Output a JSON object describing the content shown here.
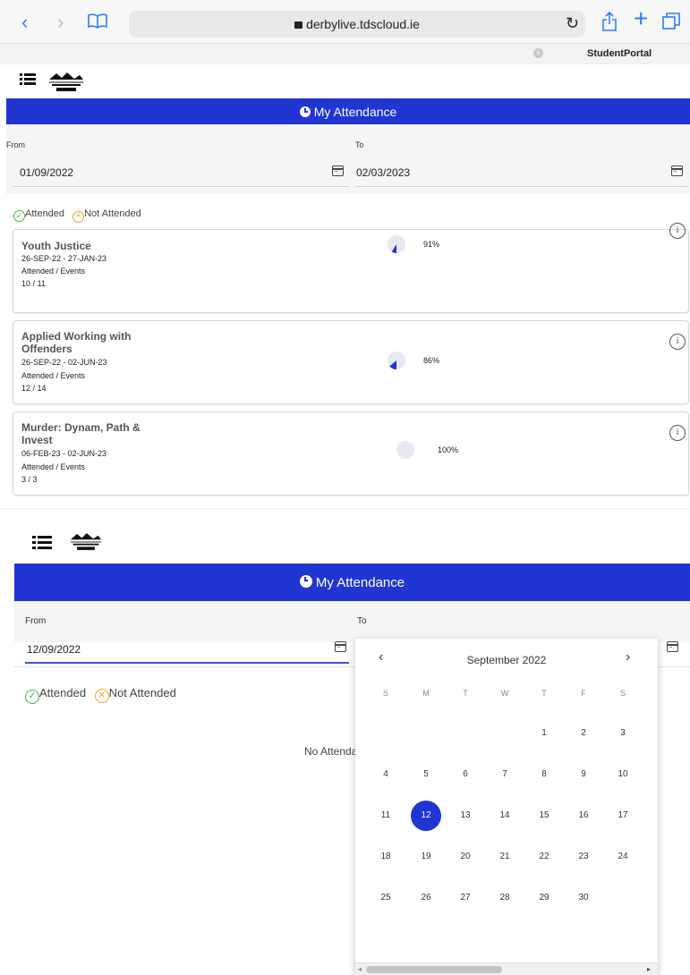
{
  "browser": {
    "back": "‹",
    "forward": "›",
    "url": "derbylive.tdscloud.ie",
    "reload": "↻",
    "share": "⇪",
    "new_tab": "+",
    "tab_label": "StudentPortal",
    "tab_close": "×",
    "accent": "#2f7cf6"
  },
  "page1": {
    "title": "My Attendance",
    "from_label": "From",
    "to_label": "To",
    "from_value": "01/09/2022",
    "to_value": "02/03/2023",
    "legend_attended": "Attended",
    "legend_not_attended": "Not Attended",
    "modules": [
      {
        "name": "Youth Justice",
        "dates": "26-SEP-22 - 27-JAN-23",
        "events_label": "Attended / Events",
        "counts": "10 / 11",
        "percent": "91%",
        "attended_fraction": 0.91
      },
      {
        "name": "Applied Working with Offenders",
        "dates": "26-SEP-22 - 02-JUN-23",
        "events_label": "Attended / Events",
        "counts": "12 / 14",
        "percent": "86%",
        "attended_fraction": 0.86
      },
      {
        "name": "Murder: Dynam, Path & Invest",
        "dates": "06-FEB-23 - 02-JUN-23",
        "events_label": "Attended / Events",
        "counts": "3 / 3",
        "percent": "100%",
        "attended_fraction": 1.0
      }
    ]
  },
  "page2": {
    "title": "My Attendance",
    "from_label": "From",
    "to_label": "To",
    "from_value": "12/09/2022",
    "legend_attended": "Attended",
    "legend_not_attended": "Not Attended",
    "no_attendance_text": "No Attenda"
  },
  "datepicker": {
    "month_label": "September 2022",
    "prev": "‹",
    "next": "›",
    "weekdays": [
      "S",
      "M",
      "T",
      "W",
      "T",
      "F",
      "S"
    ],
    "weeks": [
      [
        "",
        "",
        "",
        "",
        "1",
        "2",
        "3"
      ],
      [
        "4",
        "5",
        "6",
        "7",
        "8",
        "9",
        "10"
      ],
      [
        "11",
        "12",
        "13",
        "14",
        "15",
        "16",
        "17"
      ],
      [
        "18",
        "19",
        "20",
        "21",
        "22",
        "23",
        "24"
      ],
      [
        "25",
        "26",
        "27",
        "28",
        "29",
        "30",
        ""
      ]
    ],
    "selected_day": "12"
  },
  "colors": {
    "brand_blue": "#2035d1",
    "attended": "#3bb54a",
    "not_attended": "#f0a020",
    "pie_bg": "#e6e9f2"
  }
}
